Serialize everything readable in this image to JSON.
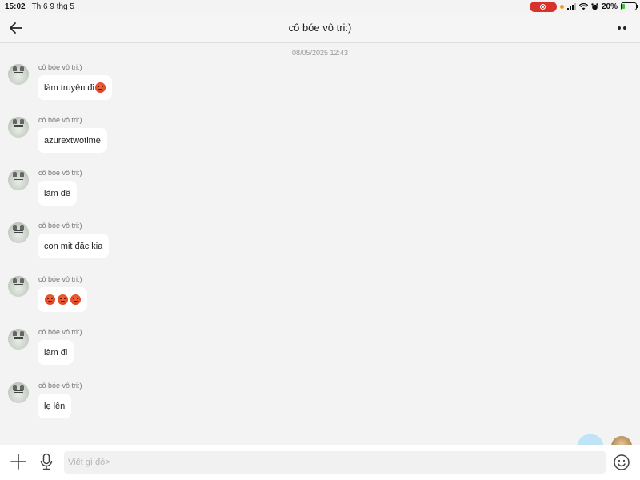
{
  "status_bar": {
    "time": "15:02",
    "date": "Th 6 9 thg 5",
    "battery_percent": "20%",
    "battery_level": 0.2,
    "recording_color": "#d8322c"
  },
  "header": {
    "title": "cô bóe vô tri:)",
    "back_icon": "arrow-left-icon",
    "more_icon": "more-dots-icon"
  },
  "chat": {
    "timestamp": "08/05/2025 12:43",
    "messages": [
      {
        "sender": "cô bóe vô tri:)",
        "text": "làm truyện đi",
        "emoji_count": 1
      },
      {
        "sender": "cô bóe vô tri:)",
        "text": "azurextwotime",
        "emoji_count": 0
      },
      {
        "sender": "cô bóe vô tri:)",
        "text": "làm đê",
        "emoji_count": 0
      },
      {
        "sender": "cô bóe vô tri:)",
        "text": "con mit đặc kia",
        "emoji_count": 0
      },
      {
        "sender": "cô bóe vô tri:)",
        "text": "",
        "emoji_count": 3
      },
      {
        "sender": "cô bóe vô tri:)",
        "text": "làm đi",
        "emoji_count": 0
      },
      {
        "sender": "cô bóe vô tri:)",
        "text": "lẹ lên",
        "emoji_count": 0
      }
    ]
  },
  "input_bar": {
    "placeholder": "Viết gì đó>",
    "value": "",
    "plus_icon": "plus-icon",
    "mic_icon": "microphone-icon",
    "emoji_icon": "smiley-icon"
  },
  "colors": {
    "background": "#f3f3f3",
    "bubble": "#ffffff",
    "own_bubble": "#bfe3f7"
  }
}
